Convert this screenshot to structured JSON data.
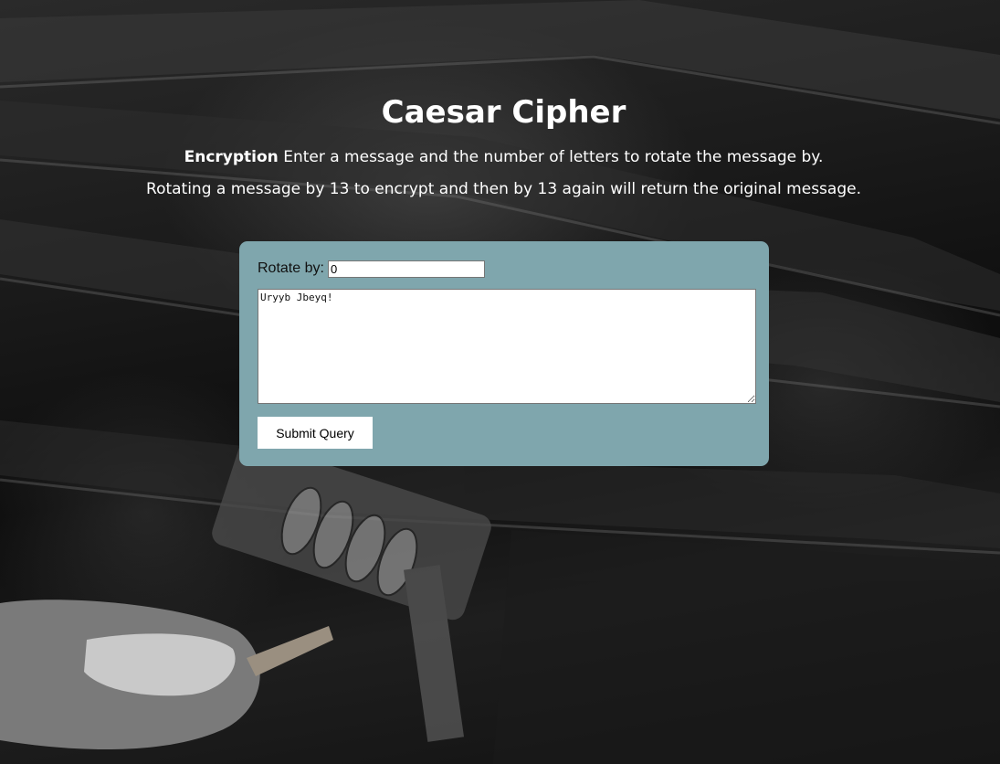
{
  "page": {
    "title": "Caesar Cipher",
    "intro_bold": "Encryption",
    "intro_text": " Enter a message and the number of letters to rotate the message by.",
    "note": "Rotating a message by 13 to encrypt and then by 13 again will return the original message."
  },
  "form": {
    "rotate_label": "Rotate by:",
    "rotate_value": "0",
    "message_value": "Uryyb Jbeyq!",
    "submit_label": "Submit Query",
    "panel_color": "#7fa6ad"
  },
  "background": {
    "description_icon": "combination-lock-photo"
  }
}
